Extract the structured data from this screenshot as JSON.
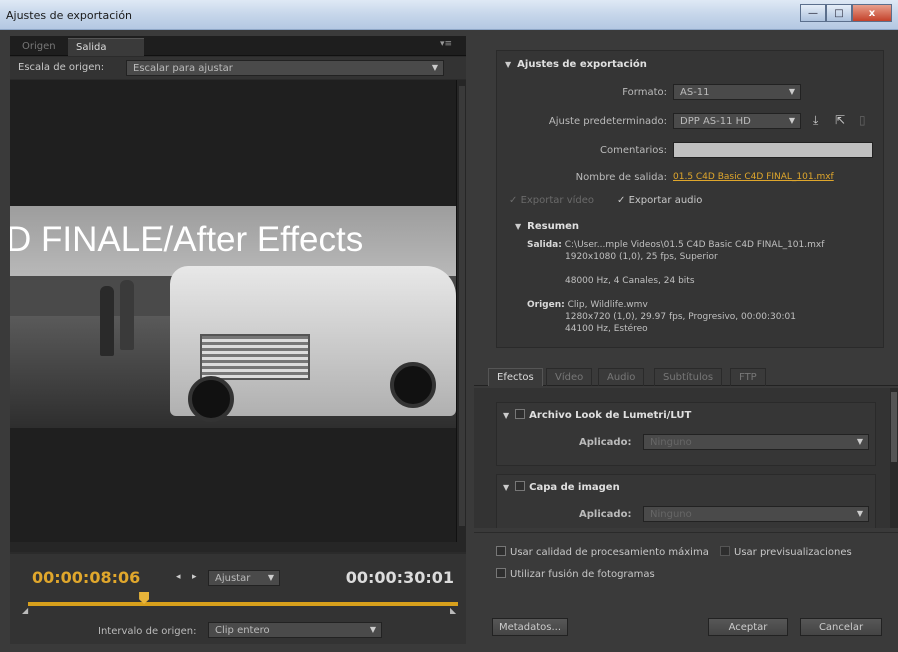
{
  "window": {
    "title": "Ajustes de exportación",
    "minimize": "—",
    "maximize": "□",
    "close": "x"
  },
  "source_panel": {
    "tabs": [
      "Origen",
      "Salida"
    ],
    "active_tab": "Salida",
    "menu_icon": "panel-menu-icon",
    "scale_label": "Escala de origen:",
    "scale_value": "Escalar para ajustar",
    "overlay_text": "D FINALE/After Effects",
    "current_timecode": "00:00:08:06",
    "fit_value": "Ajustar",
    "total_timecode": "00:00:30:01",
    "interval_label": "Intervalo de origen:",
    "interval_value": "Clip entero",
    "playhead_position": 0.27
  },
  "export_settings": {
    "section_title": "Ajustes de exportación",
    "format_label": "Formato:",
    "format_value": "AS-11",
    "preset_label": "Ajuste predeterminado:",
    "preset_value": "DPP AS-11 HD",
    "comments_label": "Comentarios:",
    "comments_value": "",
    "output_name_label": "Nombre de salida:",
    "output_name_value": "01.5 C4D Basic C4D FINAL_101.mxf",
    "export_video_label": "Exportar vídeo",
    "export_audio_label": "Exportar audio",
    "summary": {
      "title": "Resumen",
      "output_key": "Salida:",
      "output_line1": "C:\\User...mple Videos\\01.5 C4D Basic C4D FINAL_101.mxf",
      "output_line2": "1920x1080 (1,0), 25 fps, Superior",
      "output_line3": "48000 Hz, 4 Canales, 24 bits",
      "source_key": "Origen:",
      "source_line1": "Clip, Wildlife.wmv",
      "source_line2": "1280x720 (1,0), 29.97 fps, Progresivo, 00:00:30:01",
      "source_line3": "44100 Hz, Estéreo"
    }
  },
  "lower_tabs": [
    "Efectos",
    "Vídeo",
    "Audio",
    "Subtítulos",
    "FTP"
  ],
  "active_lower_tab": "Efectos",
  "effects": {
    "lumetri_title": "Archivo Look de Lumetri/LUT",
    "lumetri_applied_label": "Aplicado:",
    "lumetri_applied_value": "Ninguno",
    "image_layer_title": "Capa de imagen",
    "image_applied_label": "Aplicado:",
    "image_applied_value": "Ninguno"
  },
  "options": {
    "max_quality": "Usar calidad de procesamiento máxima",
    "use_previews": "Usar previsualizaciones",
    "frame_blending": "Utilizar fusión de fotogramas"
  },
  "buttons": {
    "metadata": "Metadatos...",
    "accept": "Aceptar",
    "cancel": "Cancelar"
  },
  "colors": {
    "accent": "#e0a72c",
    "panel": "#3a3a3a"
  }
}
